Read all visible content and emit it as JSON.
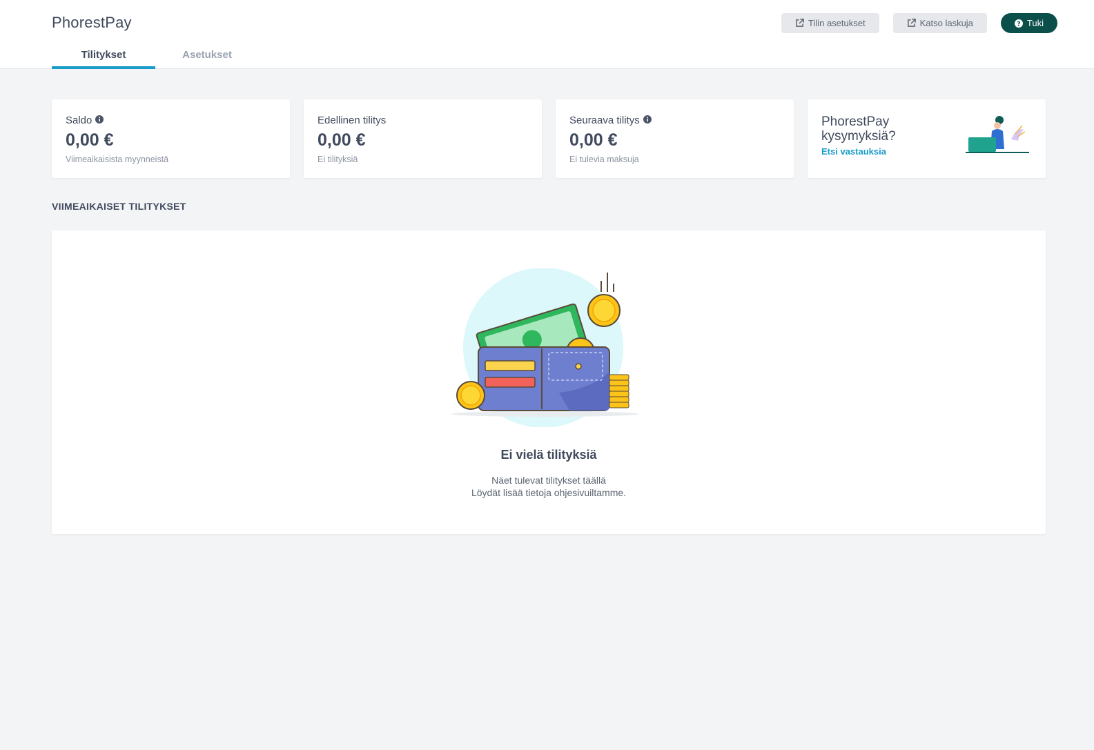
{
  "app": {
    "title": "PhorestPay"
  },
  "tabs": [
    {
      "label": "Tilitykset",
      "active": true
    },
    {
      "label": "Asetukset",
      "active": false
    }
  ],
  "actions": {
    "account_settings": "Tilin asetukset",
    "view_invoices": "Katso laskuja",
    "support": "Tuki"
  },
  "cards": {
    "balance": {
      "label": "Saldo",
      "amount": "0,00 €",
      "sub": "Viimeaikaisista myynneistä"
    },
    "previous": {
      "label": "Edellinen tilitys",
      "amount": "0,00 €",
      "sub": "Ei tilityksiä"
    },
    "next": {
      "label": "Seuraava tilitys",
      "amount": "0,00 €",
      "sub": "Ei tulevia maksuja"
    },
    "help": {
      "title": "PhorestPay kysymyksiä?",
      "link": "Etsi vastauksia"
    }
  },
  "recent": {
    "title": "VIIMEAIKAISET TILITYKSET",
    "empty_title": "Ei vielä tilityksiä",
    "empty_line1": "Näet tulevat tilitykset täällä",
    "empty_line2": "Löydät lisää tietoja ohjesivuiltamme."
  },
  "colors": {
    "accent": "#1a9cc9",
    "support_button": "#0b4f4a",
    "text": "#3f4a5c"
  }
}
